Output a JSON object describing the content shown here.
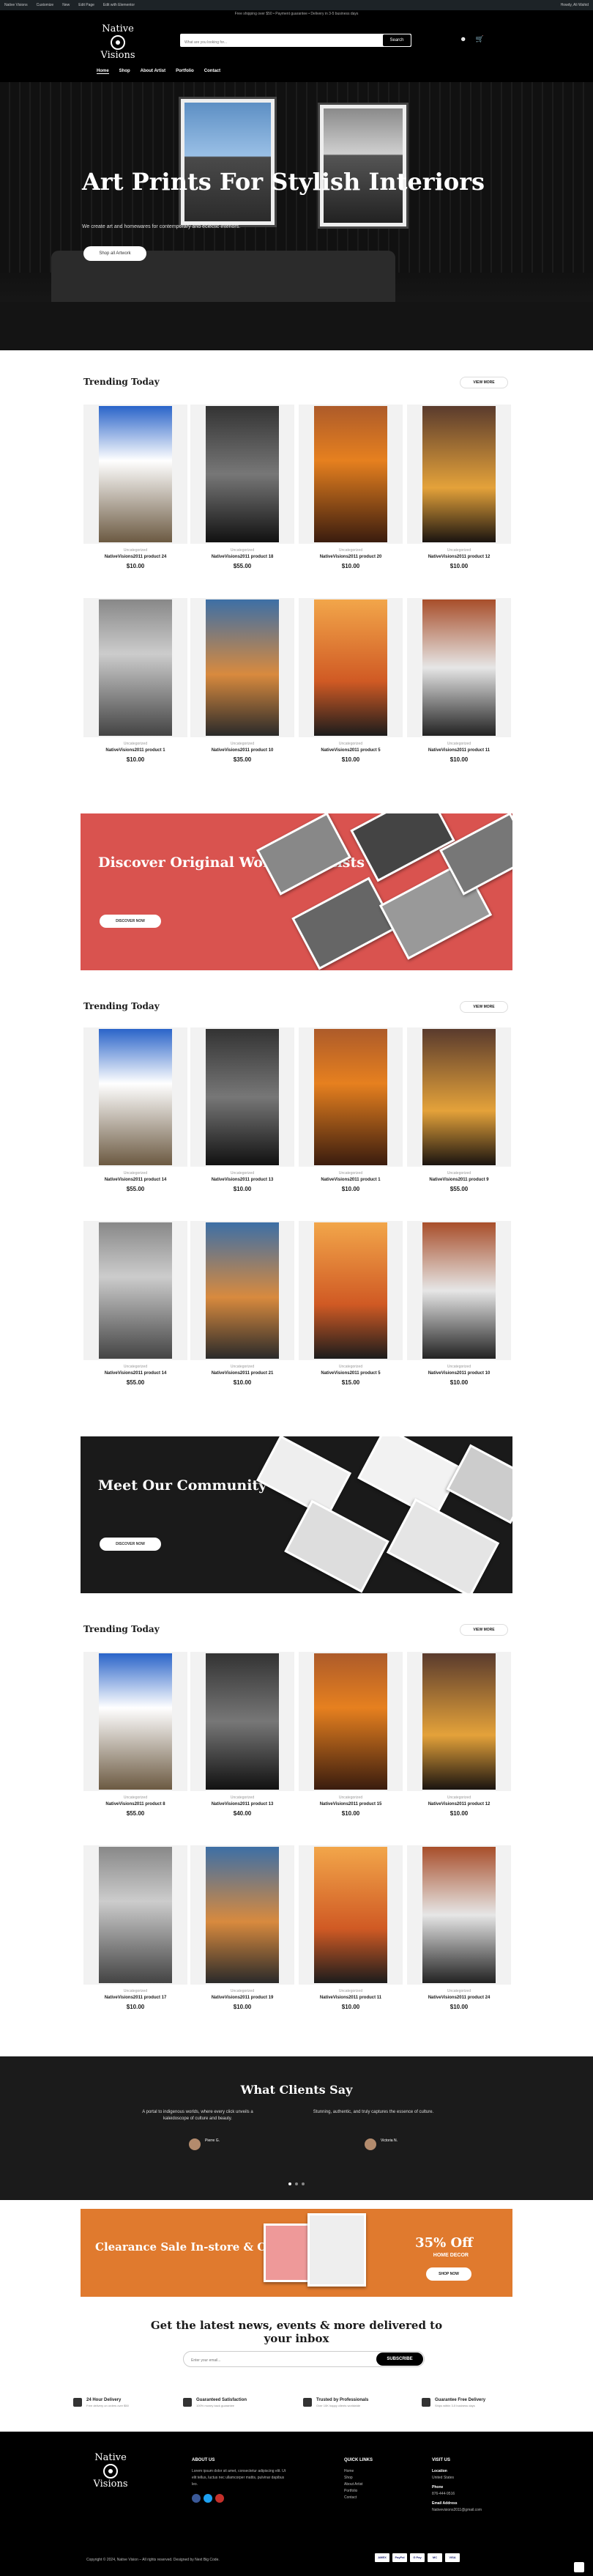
{
  "wpbar": {
    "items": [
      "Native Visions",
      "Customize",
      "New",
      "Edit Page",
      "Edit with Elementor"
    ],
    "right": "Howdy, Ali Wahid"
  },
  "promo": "Free shipping over $50 • Payment guarantee • Delivery in 3-5 business days",
  "header": {
    "logo_text": "Visions",
    "logo_top": "Native",
    "search_placeholder": "What are you looking for...",
    "search_button": "Search",
    "cart_count": "0",
    "nav": [
      "Home",
      "Shop",
      "About Artist",
      "Portfolio",
      "Contact"
    ]
  },
  "hero": {
    "title": "Art Prints For Stylish Interiors",
    "subtitle": "We create art and homewares for contemporary and eclectic interiors.",
    "cta": "Shop all Artwork"
  },
  "sections": [
    {
      "title": "Trending Today",
      "view_more": "VIEW MORE"
    },
    {
      "title": "Trending Today",
      "view_more": "VIEW MORE"
    },
    {
      "title": "Trending Today",
      "view_more": "VIEW MORE"
    }
  ],
  "products_a": [
    {
      "cat": "Uncategorized",
      "name": "NativeVisions2011 product 24",
      "price": "$10.00"
    },
    {
      "cat": "Uncategorized",
      "name": "NativeVisions2011 product 18",
      "price": "$55.00"
    },
    {
      "cat": "Uncategorized",
      "name": "NativeVisions2011 product 20",
      "price": "$10.00"
    },
    {
      "cat": "Uncategorized",
      "name": "NativeVisions2011 product 12",
      "price": "$10.00"
    },
    {
      "cat": "Uncategorized",
      "name": "NativeVisions2011 product 1",
      "price": "$10.00"
    },
    {
      "cat": "Uncategorized",
      "name": "NativeVisions2011 product 10",
      "price": "$35.00"
    },
    {
      "cat": "Uncategorized",
      "name": "NativeVisions2011 product 5",
      "price": "$10.00"
    },
    {
      "cat": "Uncategorized",
      "name": "NativeVisions2011 product 11",
      "price": "$10.00"
    }
  ],
  "products_b": [
    {
      "cat": "Uncategorized",
      "name": "NativeVisions2011 product 14",
      "price": "$55.00"
    },
    {
      "cat": "Uncategorized",
      "name": "NativeVisions2011 product 13",
      "price": "$10.00"
    },
    {
      "cat": "Uncategorized",
      "name": "NativeVisions2011 product 1",
      "price": "$10.00"
    },
    {
      "cat": "Uncategorized",
      "name": "NativeVisions2011 product 9",
      "price": "$55.00"
    },
    {
      "cat": "Uncategorized",
      "name": "NativeVisions2011 product 14",
      "price": "$55.00"
    },
    {
      "cat": "Uncategorized",
      "name": "NativeVisions2011 product 21",
      "price": "$10.00"
    },
    {
      "cat": "Uncategorized",
      "name": "NativeVisions2011 product 5",
      "price": "$15.00"
    },
    {
      "cat": "Uncategorized",
      "name": "NativeVisions2011 product 10",
      "price": "$10.00"
    }
  ],
  "products_c": [
    {
      "cat": "Uncategorized",
      "name": "NativeVisions2011 product 8",
      "price": "$55.00"
    },
    {
      "cat": "Uncategorized",
      "name": "NativeVisions2011 product 13",
      "price": "$40.00"
    },
    {
      "cat": "Uncategorized",
      "name": "NativeVisions2011 product 15",
      "price": "$10.00"
    },
    {
      "cat": "Uncategorized",
      "name": "NativeVisions2011 product 12",
      "price": "$10.00"
    },
    {
      "cat": "Uncategorized",
      "name": "NativeVisions2011 product 17",
      "price": "$10.00"
    },
    {
      "cat": "Uncategorized",
      "name": "NativeVisions2011 product 19",
      "price": "$10.00"
    },
    {
      "cat": "Uncategorized",
      "name": "NativeVisions2011 product 11",
      "price": "$10.00"
    },
    {
      "cat": "Uncategorized",
      "name": "NativeVisions2011 product 24",
      "price": "$10.00"
    }
  ],
  "banner1": {
    "title": "Discover Original Works of Artists",
    "button": "DISCOVER NOW",
    "color": "#d9534f"
  },
  "banner2": {
    "title": "Meet Our Community of Artists",
    "button": "DISCOVER NOW",
    "color": "#1a1a1a"
  },
  "testimonials": {
    "title": "What Clients Say",
    "items": [
      {
        "quote": "A portal to indigenous worlds, where every click unveils a kaleidoscope of culture and beauty.",
        "name": "Pierre G.",
        "role": "Buyer"
      },
      {
        "quote": "Stunning, authentic, and truly captures the essence of culture.",
        "name": "Victoria N.",
        "role": "Buyer"
      }
    ]
  },
  "sale": {
    "title": "Clearance Sale In-store & Online",
    "off": "35% Off",
    "sub": "HOME DECOR",
    "button": "SHOP NOW"
  },
  "newsletter": {
    "title": "Get the latest news, events & more delivered to your inbox",
    "placeholder": "Enter your email...",
    "button": "SUBSCRIBE"
  },
  "features": [
    {
      "title": "24 Hour Delivery",
      "sub": "Free delivery on orders over $50"
    },
    {
      "title": "Guaranteed Satisfaction",
      "sub": "100% money back guarantee"
    },
    {
      "title": "Trusted by Professionals",
      "sub": "Over 10K happy clients worldwide"
    },
    {
      "title": "Guarantee Free Delivery",
      "sub": "Ships within 3-5 business days"
    }
  ],
  "footer": {
    "about_title": "ABOUT US",
    "about_text": "Lorem ipsum dolor sit amet, consectetur adipiscing elit. Ut elit tellus, luctus nec ullamcorper mattis, pulvinar dapibus leo.",
    "links_title": "QUICK LINKS",
    "links": [
      "Home",
      "Shop",
      "About Artist",
      "Portfolio",
      "Contact"
    ],
    "visit_title": "VISIT US",
    "location_label": "Location",
    "location": "United States",
    "phone_label": "Phone",
    "phone": "876-444-9516",
    "email_label": "Email Address",
    "email": "Nativevisions2011@gmail.com",
    "copyright": "Copyright © 2024, Native Vision – All rights reserved. Designed by Next Big Code.",
    "payments": [
      "AMEX",
      "PayPal",
      "G Pay",
      "MC",
      "VISA"
    ]
  }
}
